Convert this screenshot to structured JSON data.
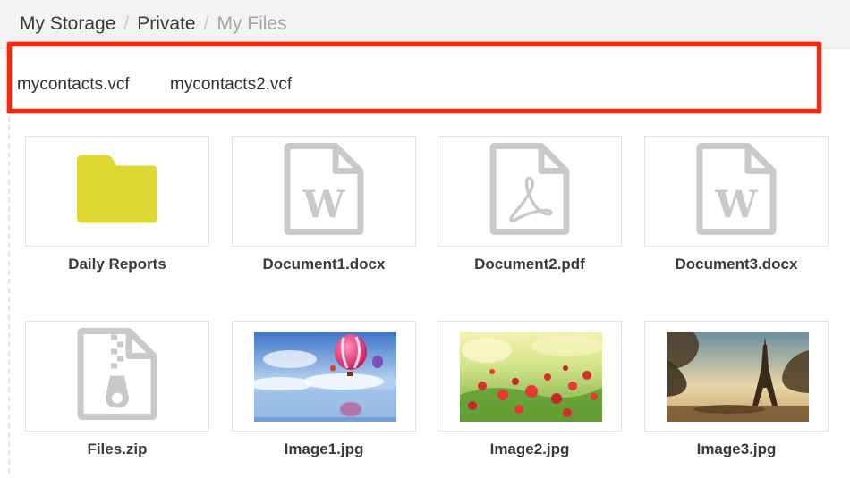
{
  "breadcrumb": {
    "items": [
      "My Storage",
      "Private",
      "My Files"
    ],
    "separator": "/"
  },
  "upload": {
    "files": [
      "mycontacts.vcf",
      "mycontacts2.vcf"
    ]
  },
  "grid": {
    "items": [
      {
        "name": "Daily Reports",
        "type": "folder",
        "icon": "folder-icon"
      },
      {
        "name": "Document1.docx",
        "type": "docx",
        "icon": "word-document-icon"
      },
      {
        "name": "Document2.pdf",
        "type": "pdf",
        "icon": "pdf-document-icon"
      },
      {
        "name": "Document3.docx",
        "type": "docx",
        "icon": "word-document-icon"
      },
      {
        "name": "Files.zip",
        "type": "zip",
        "icon": "zip-archive-icon"
      },
      {
        "name": "Image1.jpg",
        "type": "image",
        "icon": "hot-air-balloon-thumbnail"
      },
      {
        "name": "Image2.jpg",
        "type": "image",
        "icon": "poppy-field-thumbnail"
      },
      {
        "name": "Image3.jpg",
        "type": "image",
        "icon": "eiffel-tower-thumbnail"
      }
    ]
  },
  "colors": {
    "folder": "#dfd833",
    "icon_gray": "#c9c9c9",
    "highlight_red": "#f22b10"
  }
}
